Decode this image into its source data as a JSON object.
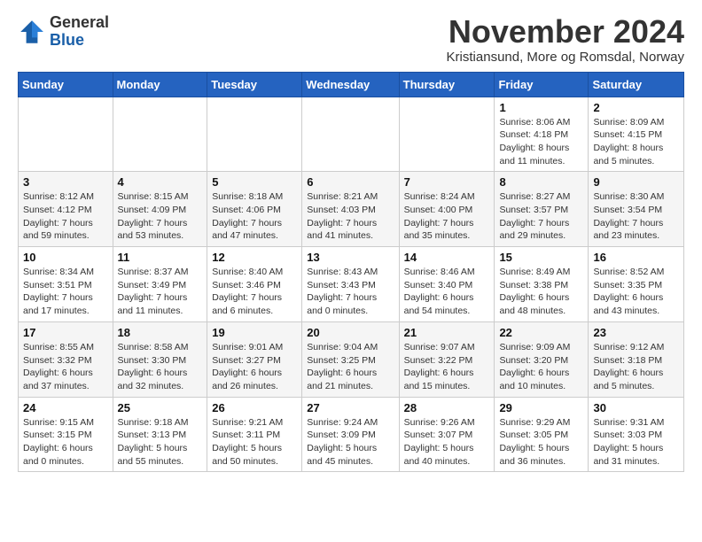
{
  "header": {
    "logo_line1": "General",
    "logo_line2": "Blue",
    "month_title": "November 2024",
    "location": "Kristiansund, More og Romsdal, Norway"
  },
  "weekdays": [
    "Sunday",
    "Monday",
    "Tuesday",
    "Wednesday",
    "Thursday",
    "Friday",
    "Saturday"
  ],
  "weeks": [
    {
      "days": [
        {
          "num": "",
          "info": ""
        },
        {
          "num": "",
          "info": ""
        },
        {
          "num": "",
          "info": ""
        },
        {
          "num": "",
          "info": ""
        },
        {
          "num": "",
          "info": ""
        },
        {
          "num": "1",
          "info": "Sunrise: 8:06 AM\nSunset: 4:18 PM\nDaylight: 8 hours and 11 minutes."
        },
        {
          "num": "2",
          "info": "Sunrise: 8:09 AM\nSunset: 4:15 PM\nDaylight: 8 hours and 5 minutes."
        }
      ]
    },
    {
      "days": [
        {
          "num": "3",
          "info": "Sunrise: 8:12 AM\nSunset: 4:12 PM\nDaylight: 7 hours and 59 minutes."
        },
        {
          "num": "4",
          "info": "Sunrise: 8:15 AM\nSunset: 4:09 PM\nDaylight: 7 hours and 53 minutes."
        },
        {
          "num": "5",
          "info": "Sunrise: 8:18 AM\nSunset: 4:06 PM\nDaylight: 7 hours and 47 minutes."
        },
        {
          "num": "6",
          "info": "Sunrise: 8:21 AM\nSunset: 4:03 PM\nDaylight: 7 hours and 41 minutes."
        },
        {
          "num": "7",
          "info": "Sunrise: 8:24 AM\nSunset: 4:00 PM\nDaylight: 7 hours and 35 minutes."
        },
        {
          "num": "8",
          "info": "Sunrise: 8:27 AM\nSunset: 3:57 PM\nDaylight: 7 hours and 29 minutes."
        },
        {
          "num": "9",
          "info": "Sunrise: 8:30 AM\nSunset: 3:54 PM\nDaylight: 7 hours and 23 minutes."
        }
      ]
    },
    {
      "days": [
        {
          "num": "10",
          "info": "Sunrise: 8:34 AM\nSunset: 3:51 PM\nDaylight: 7 hours and 17 minutes."
        },
        {
          "num": "11",
          "info": "Sunrise: 8:37 AM\nSunset: 3:49 PM\nDaylight: 7 hours and 11 minutes."
        },
        {
          "num": "12",
          "info": "Sunrise: 8:40 AM\nSunset: 3:46 PM\nDaylight: 7 hours and 6 minutes."
        },
        {
          "num": "13",
          "info": "Sunrise: 8:43 AM\nSunset: 3:43 PM\nDaylight: 7 hours and 0 minutes."
        },
        {
          "num": "14",
          "info": "Sunrise: 8:46 AM\nSunset: 3:40 PM\nDaylight: 6 hours and 54 minutes."
        },
        {
          "num": "15",
          "info": "Sunrise: 8:49 AM\nSunset: 3:38 PM\nDaylight: 6 hours and 48 minutes."
        },
        {
          "num": "16",
          "info": "Sunrise: 8:52 AM\nSunset: 3:35 PM\nDaylight: 6 hours and 43 minutes."
        }
      ]
    },
    {
      "days": [
        {
          "num": "17",
          "info": "Sunrise: 8:55 AM\nSunset: 3:32 PM\nDaylight: 6 hours and 37 minutes."
        },
        {
          "num": "18",
          "info": "Sunrise: 8:58 AM\nSunset: 3:30 PM\nDaylight: 6 hours and 32 minutes."
        },
        {
          "num": "19",
          "info": "Sunrise: 9:01 AM\nSunset: 3:27 PM\nDaylight: 6 hours and 26 minutes."
        },
        {
          "num": "20",
          "info": "Sunrise: 9:04 AM\nSunset: 3:25 PM\nDaylight: 6 hours and 21 minutes."
        },
        {
          "num": "21",
          "info": "Sunrise: 9:07 AM\nSunset: 3:22 PM\nDaylight: 6 hours and 15 minutes."
        },
        {
          "num": "22",
          "info": "Sunrise: 9:09 AM\nSunset: 3:20 PM\nDaylight: 6 hours and 10 minutes."
        },
        {
          "num": "23",
          "info": "Sunrise: 9:12 AM\nSunset: 3:18 PM\nDaylight: 6 hours and 5 minutes."
        }
      ]
    },
    {
      "days": [
        {
          "num": "24",
          "info": "Sunrise: 9:15 AM\nSunset: 3:15 PM\nDaylight: 6 hours and 0 minutes."
        },
        {
          "num": "25",
          "info": "Sunrise: 9:18 AM\nSunset: 3:13 PM\nDaylight: 5 hours and 55 minutes."
        },
        {
          "num": "26",
          "info": "Sunrise: 9:21 AM\nSunset: 3:11 PM\nDaylight: 5 hours and 50 minutes."
        },
        {
          "num": "27",
          "info": "Sunrise: 9:24 AM\nSunset: 3:09 PM\nDaylight: 5 hours and 45 minutes."
        },
        {
          "num": "28",
          "info": "Sunrise: 9:26 AM\nSunset: 3:07 PM\nDaylight: 5 hours and 40 minutes."
        },
        {
          "num": "29",
          "info": "Sunrise: 9:29 AM\nSunset: 3:05 PM\nDaylight: 5 hours and 36 minutes."
        },
        {
          "num": "30",
          "info": "Sunrise: 9:31 AM\nSunset: 3:03 PM\nDaylight: 5 hours and 31 minutes."
        }
      ]
    }
  ]
}
